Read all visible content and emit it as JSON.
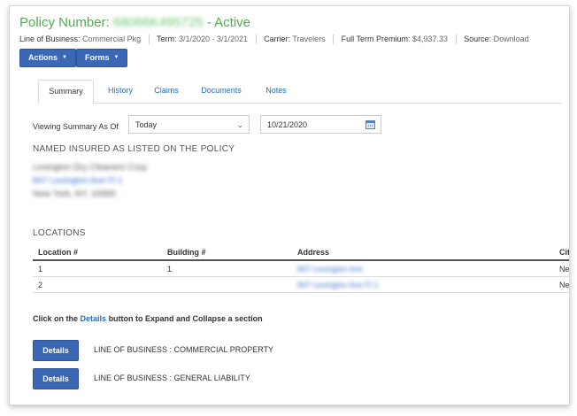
{
  "header": {
    "title_prefix": "Policy Number:",
    "policy_number": "68066K495725",
    "status": "- Active"
  },
  "meta": {
    "lob_label": "Line of Business:",
    "lob_value": "Commercial Pkg",
    "term_label": "Term:",
    "term_value": "3/1/2020 - 3/1/2021",
    "carrier_label": "Carrier:",
    "carrier_value": "Travelers",
    "premium_label": "Full Term Premium:",
    "premium_value": "$4,937.33",
    "source_label": "Source:",
    "source_value": "Download"
  },
  "toolbar": {
    "actions_label": "Actions",
    "forms_label": "Forms"
  },
  "tabs": [
    {
      "label": "Summary",
      "active": true
    },
    {
      "label": "History",
      "active": false
    },
    {
      "label": "Claims",
      "active": false
    },
    {
      "label": "Documents",
      "active": false
    },
    {
      "label": "Notes",
      "active": false
    }
  ],
  "viewing": {
    "label": "Viewing Summary As Of",
    "select_value": "Today",
    "date_value": "10/21/2020"
  },
  "named_insured": {
    "heading": "NAMED INSURED AS LISTED ON THE POLICY",
    "name": "Lexington Dry Cleaners Corp",
    "street": "847 Lexington Ave Fl 1",
    "city": "New York, NY, 10065"
  },
  "locations": {
    "heading": "LOCATIONS",
    "columns": [
      "Location #",
      "Building #",
      "Address",
      "Cit"
    ],
    "rows": [
      {
        "location": "1",
        "building": "1",
        "address": "847 Lexington Ave",
        "city": "Ne"
      },
      {
        "location": "2",
        "building": "",
        "address": "847 Lexington Ave Fl 1",
        "city": "Ne"
      }
    ]
  },
  "instructions": {
    "prefix": "Click on the",
    "link": "Details",
    "suffix": "button to Expand and Collapse a section"
  },
  "sections": [
    {
      "button_label": "Details",
      "label": "LINE OF BUSINESS : COMMERCIAL PROPERTY"
    },
    {
      "button_label": "Details",
      "label": "LINE OF BUSINESS : GENERAL LIABILITY"
    }
  ],
  "colors": {
    "status_green": "#4caf50",
    "button_blue": "#3a68b4",
    "link_blue": "#2a6db5"
  }
}
